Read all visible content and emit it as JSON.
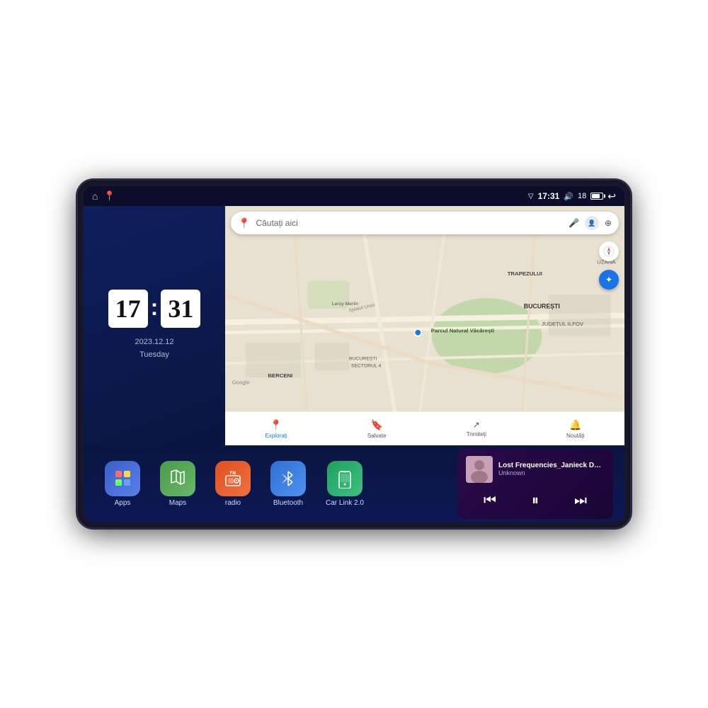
{
  "device": {
    "screen": {
      "statusBar": {
        "time": "17:31",
        "signal": "▽",
        "volume": "🔊",
        "batteryLevel": "18",
        "backIcon": "↩"
      },
      "clock": {
        "hours": "17",
        "minutes": "31",
        "date": "2023.12.12",
        "day": "Tuesday"
      },
      "map": {
        "searchPlaceholder": "Căutați aici",
        "labels": {
          "green_area": "Parcul Natural Văcărești",
          "city": "BUCUREȘTI",
          "district": "JUDEȚUL ILFOV",
          "neighborhood1": "BERCENI",
          "neighborhood2": "BUCUREȘTI SECTORUL 4",
          "street1": "Splaiul Unirii",
          "store": "Leroy Merlin",
          "trapezului": "TRAPEZULUI",
          "uzana": "UZANA"
        },
        "navItems": [
          {
            "label": "Explorați",
            "icon": "📍",
            "active": true
          },
          {
            "label": "Salvate",
            "icon": "🔖",
            "active": false
          },
          {
            "label": "Trimiteți",
            "icon": "↗",
            "active": false
          },
          {
            "label": "Noutăți",
            "icon": "🔔",
            "active": false
          }
        ]
      },
      "apps": [
        {
          "id": "apps",
          "label": "Apps",
          "iconType": "grid"
        },
        {
          "id": "maps",
          "label": "Maps",
          "iconType": "map-pin"
        },
        {
          "id": "radio",
          "label": "radio",
          "iconType": "radio"
        },
        {
          "id": "bluetooth",
          "label": "Bluetooth",
          "iconType": "bluetooth"
        },
        {
          "id": "carlink",
          "label": "Car Link 2.0",
          "iconType": "phone"
        }
      ],
      "musicPlayer": {
        "title": "Lost Frequencies_Janieck Devy-...",
        "artist": "Unknown",
        "controls": {
          "prev": "⏮",
          "play": "⏸",
          "next": "⏭"
        }
      }
    }
  }
}
